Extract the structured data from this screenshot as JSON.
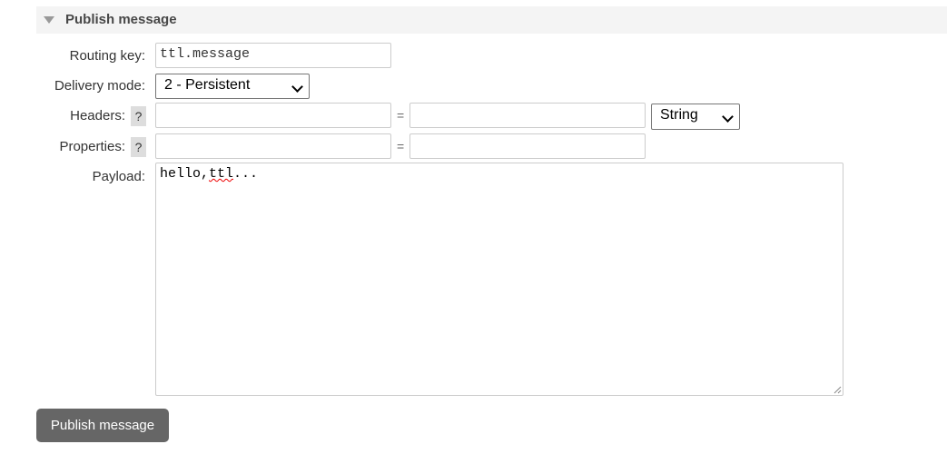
{
  "section": {
    "title": "Publish message",
    "collapse_icon": "triangle-down-icon"
  },
  "form": {
    "routing_key": {
      "label": "Routing key:",
      "value": "ttl.message"
    },
    "delivery_mode": {
      "label": "Delivery mode:",
      "value": "2 - Persistent"
    },
    "headers": {
      "label": "Headers:",
      "help": "?",
      "equals": "=",
      "key": "",
      "value": "",
      "type": "String"
    },
    "properties": {
      "label": "Properties:",
      "help": "?",
      "equals": "=",
      "key": "",
      "value": ""
    },
    "payload": {
      "label": "Payload:",
      "value_plain": "hello,",
      "value_misspelled": "ttl",
      "value_tail": "..."
    }
  },
  "publish_button": "Publish message"
}
